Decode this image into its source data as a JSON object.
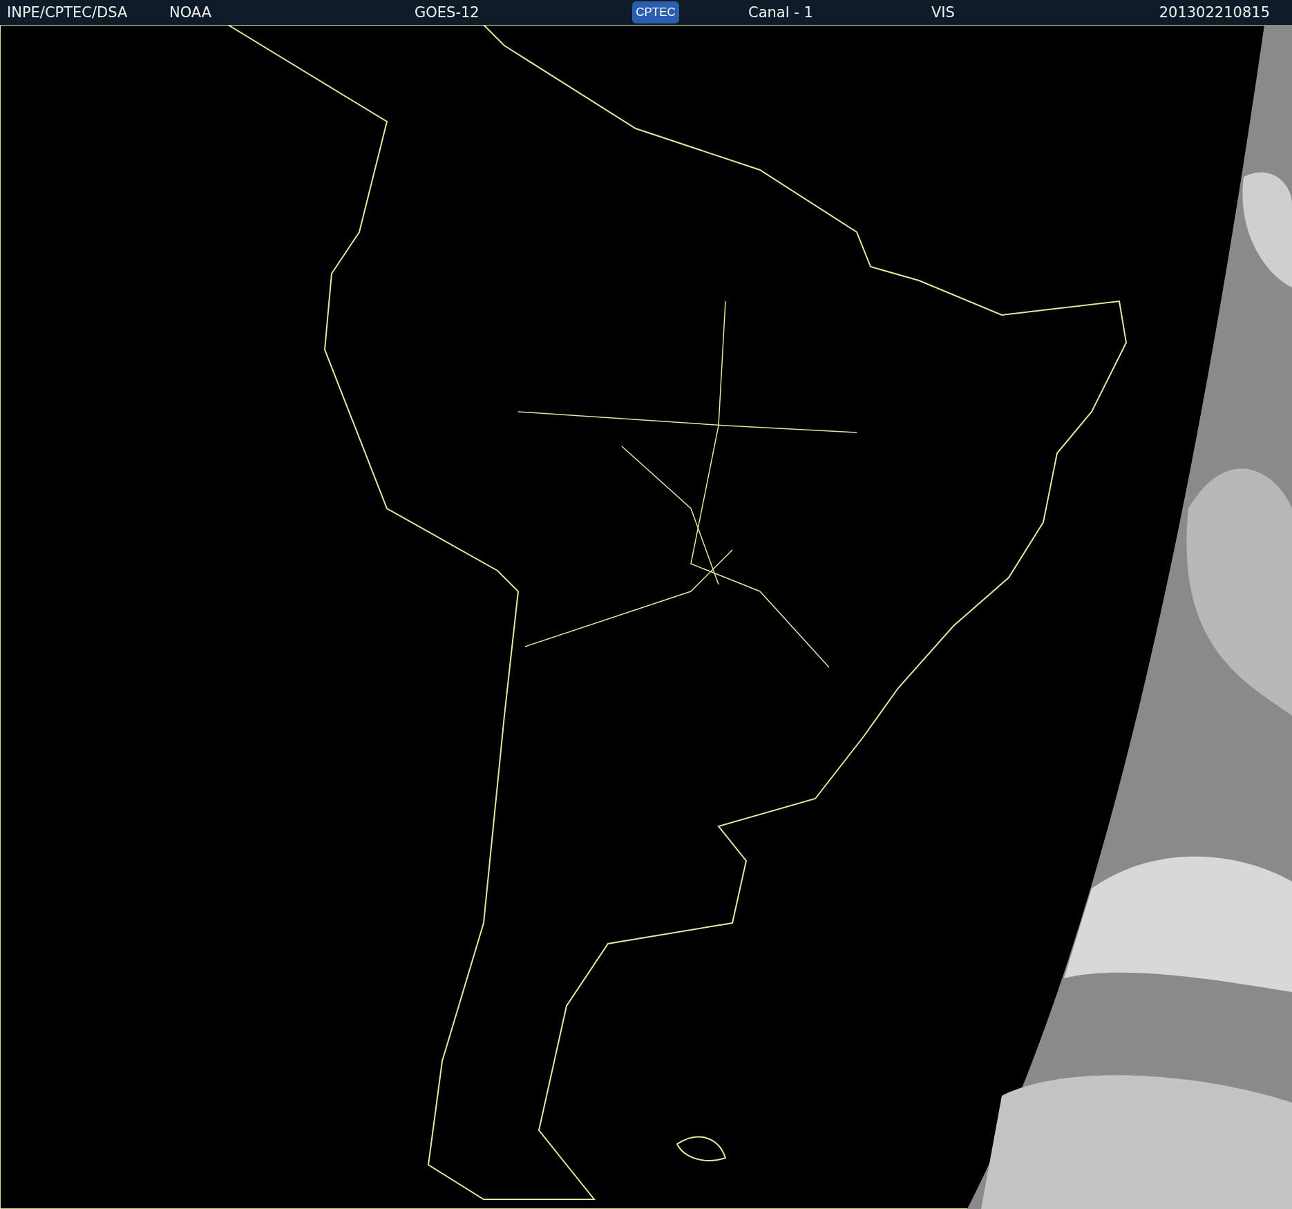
{
  "header": {
    "items": [
      {
        "kind": "text",
        "text": "INPE/CPTEC/DSA"
      },
      {
        "kind": "text",
        "text": "NOAA"
      },
      {
        "kind": "text",
        "text": "GOES-12"
      },
      {
        "kind": "logo",
        "text": "CPTEC"
      },
      {
        "kind": "text",
        "text": "Canal - 1"
      },
      {
        "kind": "text",
        "text": "VIS"
      },
      {
        "kind": "text",
        "text": "201302210815"
      }
    ]
  }
}
